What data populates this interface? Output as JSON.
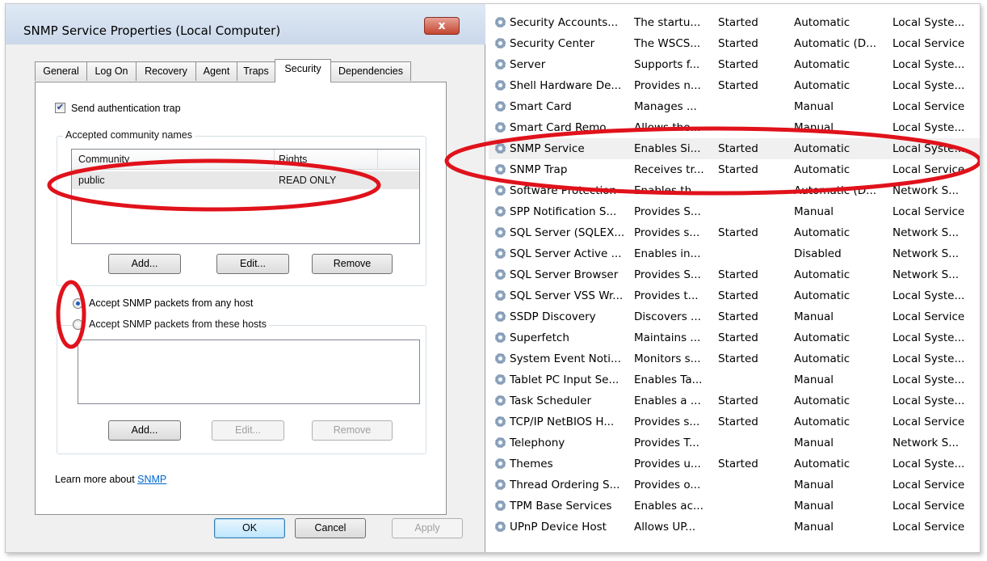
{
  "dialog": {
    "title": "SNMP Service Properties (Local Computer)",
    "close_glyph": "x",
    "tabs": [
      {
        "label": "General"
      },
      {
        "label": "Log On"
      },
      {
        "label": "Recovery"
      },
      {
        "label": "Agent"
      },
      {
        "label": "Traps"
      },
      {
        "label": "Security"
      },
      {
        "label": "Dependencies"
      }
    ],
    "active_tab": "Security",
    "send_auth_trap": {
      "label": "Send authentication trap",
      "checked": true
    },
    "community_group": {
      "title": "Accepted community names",
      "columns": [
        "Community",
        "Rights"
      ],
      "rows": [
        {
          "community": "public",
          "rights": "READ ONLY"
        }
      ],
      "add": "Add...",
      "edit": "Edit...",
      "remove": "Remove"
    },
    "radio_any": {
      "label": "Accept SNMP packets from any host",
      "selected": true
    },
    "radio_these": {
      "label": "Accept SNMP packets from these hosts",
      "selected": false
    },
    "hosts_buttons": {
      "add": "Add...",
      "edit": "Edit...",
      "remove": "Remove"
    },
    "learn_more": {
      "prefix": "Learn more about ",
      "link": "SNMP"
    },
    "footer": {
      "ok": "OK",
      "cancel": "Cancel",
      "apply": "Apply"
    }
  },
  "services": [
    {
      "name": "Security Accounts...",
      "desc": "The startu...",
      "status": "Started",
      "startup": "Automatic",
      "logon": "Local Syste..."
    },
    {
      "name": "Security Center",
      "desc": "The WSCS...",
      "status": "Started",
      "startup": "Automatic (D...",
      "logon": "Local Service"
    },
    {
      "name": "Server",
      "desc": "Supports f...",
      "status": "Started",
      "startup": "Automatic",
      "logon": "Local Syste..."
    },
    {
      "name": "Shell Hardware De...",
      "desc": "Provides n...",
      "status": "Started",
      "startup": "Automatic",
      "logon": "Local Syste..."
    },
    {
      "name": "Smart Card",
      "desc": "Manages ...",
      "status": "",
      "startup": "Manual",
      "logon": "Local Service"
    },
    {
      "name": "Smart Card Remo...",
      "desc": "Allows the...",
      "status": "",
      "startup": "Manual",
      "logon": "Local Syste..."
    },
    {
      "name": "SNMP Service",
      "desc": "Enables Si...",
      "status": "Started",
      "startup": "Automatic",
      "logon": "Local Syste..."
    },
    {
      "name": "SNMP Trap",
      "desc": "Receives tr...",
      "status": "Started",
      "startup": "Automatic",
      "logon": "Local Service"
    },
    {
      "name": "Software Protection",
      "desc": "Enables th...",
      "status": "",
      "startup": "Automatic (D...",
      "logon": "Network S..."
    },
    {
      "name": "SPP Notification S...",
      "desc": "Provides S...",
      "status": "",
      "startup": "Manual",
      "logon": "Local Service"
    },
    {
      "name": "SQL Server (SQLEX...",
      "desc": "Provides s...",
      "status": "Started",
      "startup": "Automatic",
      "logon": "Network S..."
    },
    {
      "name": "SQL Server Active ...",
      "desc": "Enables in...",
      "status": "",
      "startup": "Disabled",
      "logon": "Network S..."
    },
    {
      "name": "SQL Server Browser",
      "desc": "Provides S...",
      "status": "Started",
      "startup": "Automatic",
      "logon": "Network S..."
    },
    {
      "name": "SQL Server VSS Wr...",
      "desc": "Provides t...",
      "status": "Started",
      "startup": "Automatic",
      "logon": "Local Syste..."
    },
    {
      "name": "SSDP Discovery",
      "desc": "Discovers ...",
      "status": "Started",
      "startup": "Manual",
      "logon": "Local Service"
    },
    {
      "name": "Superfetch",
      "desc": "Maintains ...",
      "status": "Started",
      "startup": "Automatic",
      "logon": "Local Syste..."
    },
    {
      "name": "System Event Noti...",
      "desc": "Monitors s...",
      "status": "Started",
      "startup": "Automatic",
      "logon": "Local Syste..."
    },
    {
      "name": "Tablet PC Input Se...",
      "desc": "Enables Ta...",
      "status": "",
      "startup": "Manual",
      "logon": "Local Syste..."
    },
    {
      "name": "Task Scheduler",
      "desc": "Enables a ...",
      "status": "Started",
      "startup": "Automatic",
      "logon": "Local Syste..."
    },
    {
      "name": "TCP/IP NetBIOS H...",
      "desc": "Provides s...",
      "status": "Started",
      "startup": "Automatic",
      "logon": "Local Service"
    },
    {
      "name": "Telephony",
      "desc": "Provides T...",
      "status": "",
      "startup": "Manual",
      "logon": "Network S..."
    },
    {
      "name": "Themes",
      "desc": "Provides u...",
      "status": "Started",
      "startup": "Automatic",
      "logon": "Local Syste..."
    },
    {
      "name": "Thread Ordering S...",
      "desc": "Provides o...",
      "status": "",
      "startup": "Manual",
      "logon": "Local Service"
    },
    {
      "name": "TPM Base Services",
      "desc": "Enables ac...",
      "status": "",
      "startup": "Manual",
      "logon": "Local Service"
    },
    {
      "name": "UPnP Device Host",
      "desc": "Allows UP...",
      "status": "",
      "startup": "Manual",
      "logon": "Local Service"
    }
  ],
  "selected_service": "SNMP Service",
  "annotation_color": "#e0121b",
  "service_icon": "gear-icon"
}
